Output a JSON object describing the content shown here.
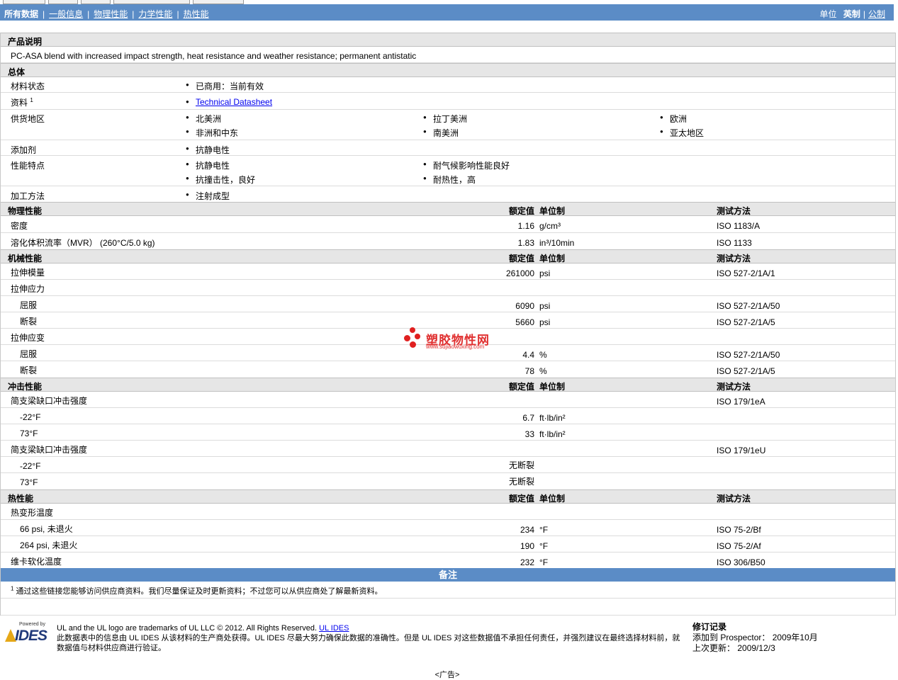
{
  "nav": {
    "all_data": "所有数据",
    "links": [
      "一般信息",
      "物理性能",
      "力学性能",
      "热性能"
    ],
    "units_label": "单位",
    "units_selected": "英制",
    "units_other": "公制"
  },
  "product": {
    "header": "产品说明",
    "description": "PC-ASA blend with increased impact strength, heat resistance and weather resistance; permanent antistatic"
  },
  "general": {
    "header": "总体",
    "material_status_label": "材料状态",
    "material_status": "已商用：当前有效",
    "documents_label": "资料",
    "documents_footnote": "1",
    "documents_link": "Technical Datasheet",
    "regions_label": "供货地区",
    "regions": [
      "北美洲",
      "拉丁美洲",
      "欧洲",
      "非洲和中东",
      "南美洲",
      "亚太地区"
    ],
    "additive_label": "添加剂",
    "additive": "抗静电性",
    "features_label": "性能特点",
    "features": [
      "抗静电性",
      "耐气候影响性能良好",
      "抗撞击性，良好",
      "耐热性，高"
    ],
    "processing_label": "加工方法",
    "processing": "注射成型"
  },
  "col_headers": {
    "nominal": "额定值",
    "unit": "单位制",
    "test": "测试方法"
  },
  "physical": {
    "header": "物理性能",
    "rows": [
      {
        "label": "密度",
        "value": "1.16",
        "unit": "g/cm³",
        "test": "ISO 1183/A"
      },
      {
        "label": "溶化体积流率（MVR） (260°C/5.0 kg)",
        "value": "1.83",
        "unit": "in³/10min",
        "test": "ISO 1133"
      }
    ]
  },
  "mechanical": {
    "header": "机械性能",
    "tensile_modulus": {
      "label": "拉伸模量",
      "value": "261000",
      "unit": "psi",
      "test": "ISO 527-2/1A/1"
    },
    "tensile_stress_label": "拉伸应力",
    "stress_yield": {
      "label": "屈服",
      "value": "6090",
      "unit": "psi",
      "test": "ISO 527-2/1A/50"
    },
    "stress_break": {
      "label": "断裂",
      "value": "5660",
      "unit": "psi",
      "test": "ISO 527-2/1A/5"
    },
    "tensile_strain_label": "拉伸应变",
    "strain_yield": {
      "label": "屈服",
      "value": "4.4",
      "unit": "%",
      "test": "ISO 527-2/1A/50"
    },
    "strain_break": {
      "label": "断裂",
      "value": "78",
      "unit": "%",
      "test": "ISO 527-2/1A/5"
    }
  },
  "impact": {
    "header": "冲击性能",
    "notched_label": "简支梁缺口冲击强度",
    "notched_test": "ISO 179/1eA",
    "notched_m22": {
      "label": "-22°F",
      "value": "6.7",
      "unit": "ft·lb/in²"
    },
    "notched_73": {
      "label": "73°F",
      "value": "33",
      "unit": "ft·lb/in²"
    },
    "unnotched_label": "简支梁缺口冲击强度",
    "unnotched_test": "ISO 179/1eU",
    "unnotched_m22": {
      "label": "-22°F",
      "value": "无断裂"
    },
    "unnotched_73": {
      "label": "73°F",
      "value": "无断裂"
    }
  },
  "thermal": {
    "header": "热性能",
    "hdt_label": "热变形温度",
    "hdt_66": {
      "label": "66 psi, 未退火",
      "value": "234",
      "unit": "°F",
      "test": "ISO 75-2/Bf"
    },
    "hdt_264": {
      "label": "264 psi, 未退火",
      "value": "190",
      "unit": "°F",
      "test": "ISO 75-2/Af"
    },
    "vicat": {
      "label": "维卡软化温度",
      "value": "232",
      "unit": "°F",
      "test": "ISO 306/B50"
    }
  },
  "notes": {
    "header": "备注",
    "footnote_num": "1",
    "footnote": "通过这些链接您能够访问供应商资料。我们尽量保证及时更新资料；不过您可以从供应商处了解最新资料。"
  },
  "footer": {
    "powered_by": "Powered by",
    "logo": "IDES",
    "trademark": "UL and the UL logo are trademarks of UL LLC © 2012. All Rights Reserved.",
    "ul_ides_link": "UL IDES",
    "disclaimer": "此数据表中的信息由  UL IDES 从该材料的生产商处获得。UL IDES 尽最大努力确保此数据的准确性。但是  UL IDES 对这些数据值不承担任何责任，并强烈建议在最终选择材料前，就数据值与材料供应商进行验证。",
    "rev_title": "修订记录",
    "rev_added_label": "添加到 Prospector：",
    "rev_added": "2009年10月",
    "rev_updated_label": "上次更新：",
    "rev_updated": "2009/12/3"
  },
  "watermark": {
    "title": "塑胶物性网",
    "url": "www.sujiaowuxing.com"
  },
  "ad": "<广告>",
  "colors": {
    "nav_bar": "#5b8cc6",
    "section_bg": "#e6e6e6",
    "link": "#0000ee",
    "watermark": "#e02020"
  }
}
